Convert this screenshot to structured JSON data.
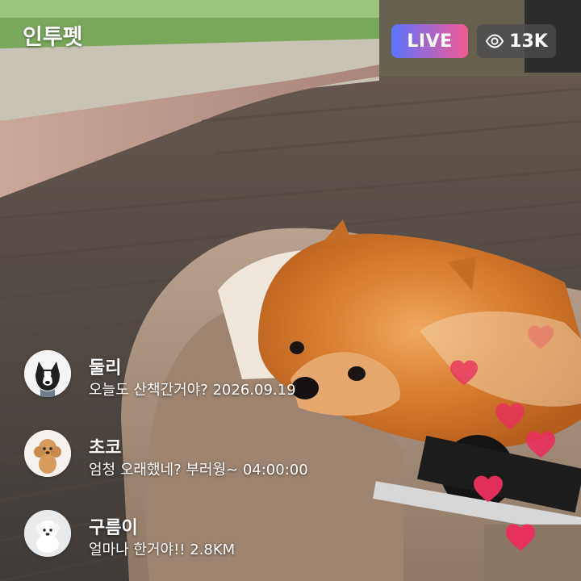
{
  "app": {
    "name": "인투펫"
  },
  "header": {
    "live_label": "LIVE",
    "viewer_count": "13K",
    "live_gradient": [
      "#5c73ff",
      "#f25a91"
    ]
  },
  "comments": [
    {
      "name": "둘리",
      "text": "오늘도 산책간거야? 2026.09.19",
      "avatar": "dog-black-white-icon"
    },
    {
      "name": "초코",
      "text": "엄청 오래했네? 부러웡~ 04:00:00",
      "avatar": "dog-poodle-icon"
    },
    {
      "name": "구름이",
      "text": "얼마나 한거야!! 2.8KM",
      "avatar": "dog-white-icon"
    }
  ],
  "icons": {
    "viewer": "eye-icon",
    "reaction": "heart-icon"
  },
  "colors": {
    "heart": "#ea2f5e",
    "viewer_pill_bg": "#4b4b50"
  }
}
